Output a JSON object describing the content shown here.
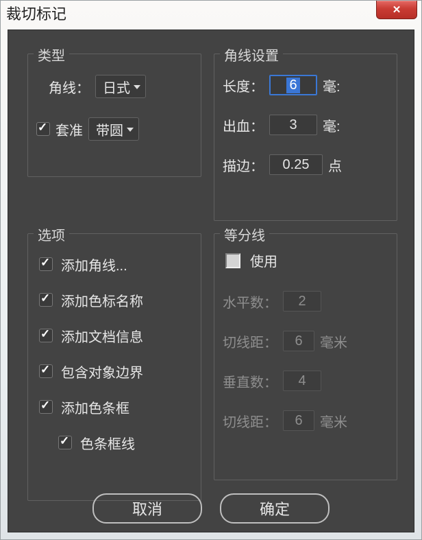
{
  "window": {
    "title": "裁切标记"
  },
  "type_panel": {
    "title": "类型",
    "corner_label": "角线：",
    "corner_value": "日式",
    "reg_label": "套准",
    "reg_checked": true,
    "reg_value": "带圆"
  },
  "corner_panel": {
    "title": "角线设置",
    "length_label": "长度：",
    "length_value": "6",
    "length_unit": "毫:",
    "bleed_label": "出血：",
    "bleed_value": "3",
    "bleed_unit": "毫:",
    "stroke_label": "描边：",
    "stroke_value": "0.25",
    "stroke_unit": "点"
  },
  "options_panel": {
    "title": "选项",
    "items": [
      {
        "label": "添加角线...",
        "checked": true
      },
      {
        "label": "添加色标名称",
        "checked": true
      },
      {
        "label": "添加文档信息",
        "checked": true
      },
      {
        "label": "包含对象边界",
        "checked": true
      },
      {
        "label": "添加色条框",
        "checked": true
      }
    ],
    "sub_item": {
      "label": "色条框线",
      "checked": true
    }
  },
  "div_panel": {
    "title": "等分线",
    "use_label": "使用",
    "use_checked": false,
    "hcount_label": "水平数：",
    "hcount_value": "2",
    "hdist_label": "切线距：",
    "hdist_value": "6",
    "hdist_unit": "毫米",
    "vcount_label": "垂直数：",
    "vcount_value": "4",
    "vdist_label": "切线距：",
    "vdist_value": "6",
    "vdist_unit": "毫米"
  },
  "buttons": {
    "cancel": "取消",
    "ok": "确定"
  }
}
